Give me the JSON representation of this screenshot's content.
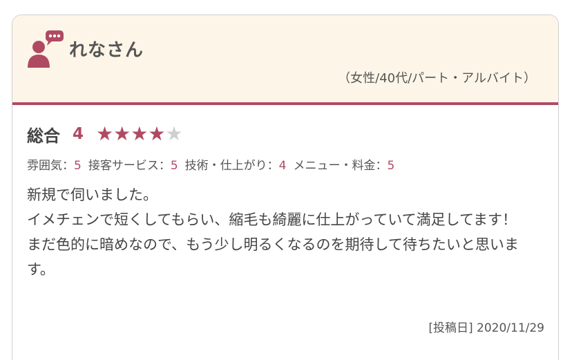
{
  "reviewer": {
    "name": "れなさん",
    "profile": "（女性/40代/パート・アルバイト）"
  },
  "overall": {
    "label": "総合",
    "score": "4",
    "stars_filled": 4,
    "stars_total": 5
  },
  "sub_ratings": [
    {
      "label": "雰囲気：",
      "value": "5"
    },
    {
      "label": "接客サービス：",
      "value": "5"
    },
    {
      "label": "技術・仕上がり：",
      "value": "4"
    },
    {
      "label": "メニュー・料金：",
      "value": "5"
    }
  ],
  "review_text": "新規で伺いました。\nイメチェンで短くしてもらい、縮毛も綺麗に仕上がっていて満足してます！\nまだ色的に暗めなので、もう少し明るくなるのを期待して待ちたいと思います。",
  "posted": "[投稿日] 2020/11/29",
  "colors": {
    "accent": "#b04a63",
    "header_bg": "#fdf6e8",
    "star_empty": "#cfcfcf"
  },
  "icons": {
    "avatar": "user-comment-icon",
    "star": "star-icon"
  }
}
